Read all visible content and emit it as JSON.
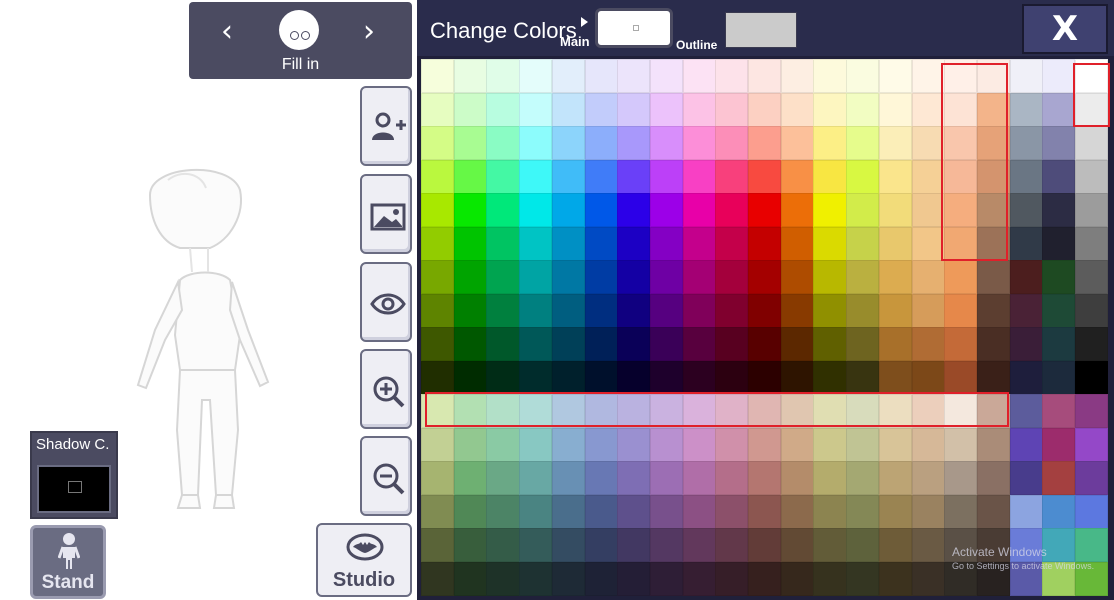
{
  "top_selector": {
    "label": "Fill in",
    "prev_icon": "chevron-left",
    "next_icon": "chevron-right"
  },
  "tools": [
    {
      "name": "add-person-button",
      "icon": "add-person-icon"
    },
    {
      "name": "background-button",
      "icon": "image-icon"
    },
    {
      "name": "visibility-button",
      "icon": "eye-icon"
    },
    {
      "name": "zoom-in-button",
      "icon": "zoom-in-icon"
    },
    {
      "name": "zoom-out-button",
      "icon": "zoom-out-icon"
    }
  ],
  "studio": {
    "label": "Studio",
    "icon": "bat-icon"
  },
  "shadow": {
    "label": "Shadow C.",
    "color": "#000000"
  },
  "stand": {
    "label": "Stand",
    "icon": "person-icon"
  },
  "panel": {
    "title": "Change Colors",
    "main_label": "Main",
    "outline_label": "Outline",
    "main_color": "#ffffff",
    "outline_color": "#cbcbcb",
    "close_label": "X"
  },
  "palette": {
    "rows": [
      [
        "#f6fedc",
        "#e8fde2",
        "#e0fde8",
        "#e4fdfb",
        "#e2eefb",
        "#e6e6fb",
        "#ece4fb",
        "#f4e2fb",
        "#fce2f4",
        "#fde2ea",
        "#fde6e2",
        "#fdeee2",
        "#fdfadc",
        "#fafce0",
        "#fffbe8",
        "#fff4e8",
        "#fff0e8",
        "#fcebe3",
        "#f0f0f8",
        "#ecebfb",
        "#ffffff"
      ],
      [
        "#e6fdc0",
        "#ccfcc8",
        "#b8fde0",
        "#c4fdfc",
        "#c2e4fb",
        "#c2ccfb",
        "#d4c8fb",
        "#ecc2fb",
        "#fcc2e6",
        "#fcc4d2",
        "#fcd0c2",
        "#fde0c8",
        "#fdf6c0",
        "#f2fdc2",
        "#fff7d8",
        "#fee8d4",
        "#fde3d5",
        "#f3b48a",
        "#aab6c4",
        "#a8a6d0",
        "#ececec"
      ],
      [
        "#d4fc86",
        "#a8fc92",
        "#8afcc4",
        "#8cfcfc",
        "#8cd4fb",
        "#8caefb",
        "#a898fb",
        "#d88efb",
        "#fc8ed8",
        "#fc8eb8",
        "#fc9e8e",
        "#fcc09a",
        "#fcef86",
        "#e6fc8c",
        "#fbeeb8",
        "#f7dbb2",
        "#f9c6ac",
        "#e6a278",
        "#8a96a6",
        "#8282ac",
        "#d6d6d6"
      ],
      [
        "#baf83e",
        "#66f846",
        "#44f8a4",
        "#3ef8f8",
        "#40bcf8",
        "#407cf8",
        "#6a40f8",
        "#bc40f8",
        "#f840c4",
        "#f8407c",
        "#f84a40",
        "#f89046",
        "#f8e642",
        "#d8f842",
        "#fae58c",
        "#f5d096",
        "#f6b898",
        "#d4946e",
        "#6a7684",
        "#4e4c7a",
        "#bcbcbc"
      ],
      [
        "#a8e800",
        "#08e800",
        "#00e87a",
        "#00e8e8",
        "#00a8e8",
        "#0058e8",
        "#2c00e8",
        "#9c00e8",
        "#e800a8",
        "#e8005a",
        "#e80000",
        "#ec6e08",
        "#f0f000",
        "#d2ec4a",
        "#f2dc7a",
        "#f0c890",
        "#f5ad7e",
        "#b88a68",
        "#505860",
        "#2c2c44",
        "#9c9c9c"
      ],
      [
        "#92cc00",
        "#00c400",
        "#00c462",
        "#00c4c4",
        "#0090c4",
        "#004ac4",
        "#1c00c4",
        "#8400c4",
        "#c4008c",
        "#c4004a",
        "#c40000",
        "#d05e00",
        "#dada00",
        "#c6d24a",
        "#e8c86c",
        "#f2c688",
        "#f1a872",
        "#9c7258",
        "#303a48",
        "#20202e",
        "#7e7e7e"
      ],
      [
        "#78a800",
        "#00a400",
        "#00a450",
        "#00a4a4",
        "#0078a4",
        "#003ca4",
        "#1400a4",
        "#6e00a4",
        "#a40074",
        "#a4003c",
        "#a40000",
        "#ae4c00",
        "#b8b800",
        "#bab040",
        "#dcac50",
        "#e6b070",
        "#ee9a5a",
        "#7a5a48",
        "#4c1e1e",
        "#1e4a22",
        "#5c5c5c"
      ],
      [
        "#5e8400",
        "#008000",
        "#00803e",
        "#008080",
        "#005e80",
        "#002e80",
        "#100080",
        "#560080",
        "#80005a",
        "#80002e",
        "#800000",
        "#883a00",
        "#909000",
        "#988c2c",
        "#c8963c",
        "#d69c5a",
        "#e6884a",
        "#5c3e30",
        "#4a2236",
        "#1e4a36",
        "#3e3e3e"
      ],
      [
        "#3e5800",
        "#005800",
        "#00582a",
        "#005858",
        "#004058",
        "#002058",
        "#0a0058",
        "#3a0058",
        "#58003e",
        "#580020",
        "#580000",
        "#5c2800",
        "#606000",
        "#6e6420",
        "#a8702a",
        "#b06c34",
        "#c46a38",
        "#4a2e24",
        "#3a1e38",
        "#1c3a40",
        "#202020"
      ],
      [
        "#202e00",
        "#002c00",
        "#002c16",
        "#002c2c",
        "#00202c",
        "#00102c",
        "#06002c",
        "#1e002c",
        "#2c0020",
        "#2c0010",
        "#2c0000",
        "#2e1400",
        "#303000",
        "#383410",
        "#7e4e1c",
        "#7c4818",
        "#9a4a28",
        "#3a2018",
        "#1e1e3c",
        "#1c2a3c",
        "#000000"
      ],
      [
        "#d8e8b0",
        "#b2e0b2",
        "#b2e0c8",
        "#b0dcd8",
        "#b0c8e0",
        "#b0b8e0",
        "#bab2e0",
        "#cab2e0",
        "#dab2dc",
        "#e0b2c8",
        "#e0b6b2",
        "#e0c6b0",
        "#e0deb2",
        "#d8dcbc",
        "#ecdec0",
        "#eccfbc",
        "#f4e8de",
        "#caa898",
        "#5c5c9c",
        "#a64c7c",
        "#8a3a84"
      ],
      [
        "#c2d094",
        "#92c890",
        "#8acaa4",
        "#88c8c2",
        "#88aed0",
        "#8898d0",
        "#9a90d0",
        "#b890d0",
        "#cc90c8",
        "#d090aa",
        "#d09890",
        "#d0aa88",
        "#ccc88c",
        "#c0c494",
        "#d8c498",
        "#d6b898",
        "#d2c0a8",
        "#aa8c78",
        "#5e44b4",
        "#9c2c6c",
        "#9448c8"
      ],
      [
        "#a6b470",
        "#6eb072",
        "#6aa886",
        "#68a8a4",
        "#6890b4",
        "#6878b4",
        "#7e6eb4",
        "#9c6eb4",
        "#b06ea8",
        "#b46e8a",
        "#b47670",
        "#b48c6a",
        "#b4ac6c",
        "#a4a872",
        "#bca474",
        "#baa080",
        "#a8988a",
        "#8a7064",
        "#483c8c",
        "#a44040",
        "#6c3c9c"
      ],
      [
        "#808c52",
        "#508856",
        "#4c8466",
        "#4a8482",
        "#4a6e8c",
        "#4a5a8c",
        "#5e508c",
        "#78508c",
        "#8c5084",
        "#8c506a",
        "#8c5650",
        "#8c6a4c",
        "#8c8450",
        "#848856",
        "#9a8452",
        "#9a8260",
        "#7c7060",
        "#6a5448",
        "#8ca4e0",
        "#4c8cd0",
        "#5c78e0"
      ],
      [
        "#5a6438",
        "#385e3c",
        "#345c48",
        "#345c5a",
        "#344c62",
        "#343e62",
        "#423862",
        "#543862",
        "#62385c",
        "#62384a",
        "#623c38",
        "#624a34",
        "#625c38",
        "#5e623c",
        "#6e5c38",
        "#6a5a44",
        "#5a5046",
        "#4a3c34",
        "#6a7cd8",
        "#42a8b8",
        "#48b888"
      ],
      [
        "#303620",
        "#203420",
        "#1e3228",
        "#1e3232",
        "#1e2a36",
        "#1e2236",
        "#241e36",
        "#2e1e36",
        "#361e32",
        "#361e28",
        "#36201e",
        "#36281c",
        "#36321e",
        "#343622",
        "#3c321e",
        "#3a3026",
        "#302c26",
        "#282220",
        "#5a5aa8",
        "#a0d060",
        "#68b838"
      ]
    ]
  },
  "watermark": {
    "line1": "Activate Windows",
    "line2": "Go to Settings to activate Windows."
  }
}
